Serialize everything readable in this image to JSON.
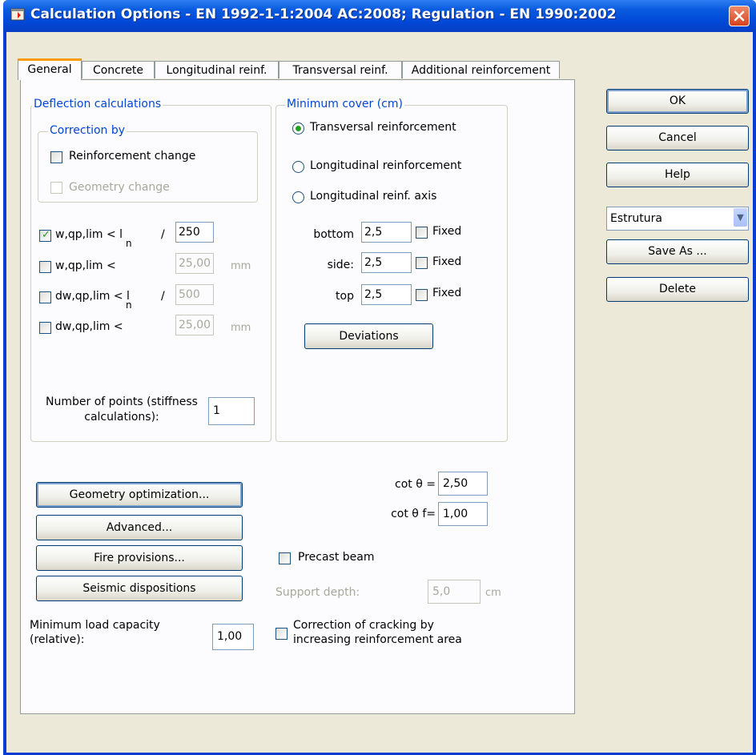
{
  "window": {
    "title": "Calculation Options - EN 1992-1-1:2004 AC:2008;  Regulation - EN 1990:2002"
  },
  "tabs": [
    {
      "label": "General",
      "active": true
    },
    {
      "label": "Concrete",
      "active": false
    },
    {
      "label": "Longitudinal reinf.",
      "active": false
    },
    {
      "label": "Transversal reinf.",
      "active": false
    },
    {
      "label": "Additional reinforcement",
      "active": false
    }
  ],
  "deflection": {
    "legend": "Deflection calculations",
    "correction_legend": "Correction by",
    "reinforcement_change": "Reinforcement change",
    "geometry_change": "Geometry change",
    "rows": [
      {
        "label": "w,qp,lim < l",
        "sub": "n",
        "slash": "/",
        "value": "250",
        "unit": "",
        "checked": true
      },
      {
        "label": "w,qp,lim <",
        "sub": "",
        "slash": "",
        "value": "25,00",
        "unit": "mm",
        "checked": false
      },
      {
        "label": "dw,qp,lim < l",
        "sub": "n",
        "slash": "/",
        "value": "500",
        "unit": "",
        "checked": false
      },
      {
        "label": "dw,qp,lim <",
        "sub": "",
        "slash": "",
        "value": "25,00",
        "unit": "mm",
        "checked": false
      }
    ],
    "points_label_1": "Number of points (stiffness",
    "points_label_2": "calculations):",
    "points_value": "1"
  },
  "cover": {
    "legend": "Minimum cover (cm)",
    "options": [
      "Transversal reinforcement",
      "Longitudinal reinforcement",
      "Longitudinal reinf. axis"
    ],
    "selected": 0,
    "rows": [
      {
        "label": "bottom",
        "value": "2,5",
        "fixed": "Fixed"
      },
      {
        "label": "side:",
        "value": "2,5",
        "fixed": "Fixed"
      },
      {
        "label": "top",
        "value": "2,5",
        "fixed": "Fixed"
      }
    ],
    "deviations": "Deviations"
  },
  "buttons_left": {
    "geometry": "Geometry optimization...",
    "advanced": "Advanced...",
    "fire": "Fire provisions...",
    "seismic": "Seismic dispositions"
  },
  "cot": {
    "theta_label": "cot θ  =",
    "theta_value": "2,50",
    "theta_f_label": "cot θ f=",
    "theta_f_value": "1,00"
  },
  "precast": {
    "label": "Precast beam",
    "support_label": "Support depth:",
    "support_value": "5,0",
    "support_unit": "cm"
  },
  "load": {
    "label_1": "Minimum load capacity",
    "label_2": "(relative):",
    "value": "1,00"
  },
  "cracking": {
    "label_1": "Correction of cracking by",
    "label_2": "increasing reinforcement area"
  },
  "right": {
    "ok": "OK",
    "cancel": "Cancel",
    "help": "Help",
    "preset": "Estrutura",
    "save_as": "Save As ...",
    "delete": "Delete"
  },
  "colors": {
    "title_bar": "#0047d6",
    "legend_text": "#0046d5",
    "tab_highlight": "#ff9a00",
    "check_mark": "#21a121"
  }
}
